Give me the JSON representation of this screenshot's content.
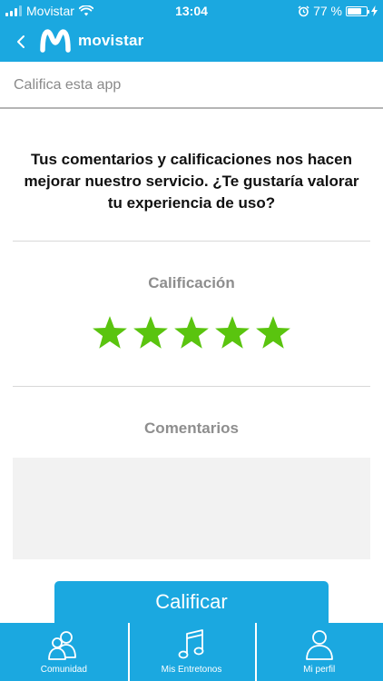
{
  "status_bar": {
    "carrier": "Movistar",
    "time": "13:04",
    "battery_percent": "77 %",
    "battery_level": 0.77
  },
  "header": {
    "brand_name": "movistar",
    "back_icon": "chevron-left-icon",
    "logo_icon": "movistar-m-logo"
  },
  "page": {
    "title": "Califica esta app",
    "intro": "Tus comentarios y calificaciones nos hacen mejorar nuestro servicio. ¿Te gustaría valorar tu experiencia de uso?"
  },
  "rating": {
    "label": "Calificación",
    "value": 5,
    "max": 5,
    "star_color": "#5ac40f"
  },
  "comments": {
    "label": "Comentarios",
    "value": ""
  },
  "submit": {
    "label": "Calificar"
  },
  "tabs": [
    {
      "label": "Comunidad",
      "icon": "community-icon"
    },
    {
      "label": "Mis Entretonos",
      "icon": "music-note-icon"
    },
    {
      "label": "Mi perfil",
      "icon": "profile-icon"
    }
  ],
  "colors": {
    "brand_blue": "#1ba8e0",
    "star_green": "#5ac40f"
  }
}
